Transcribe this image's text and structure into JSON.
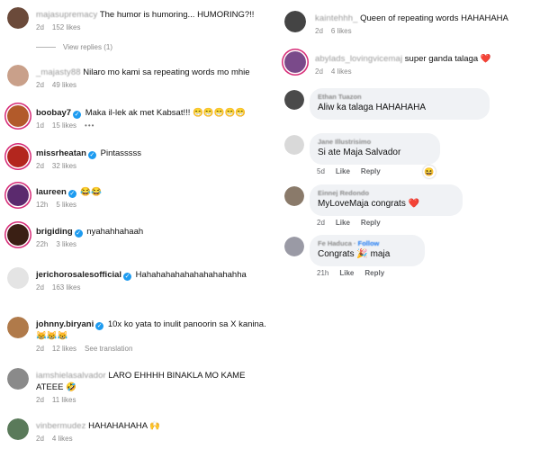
{
  "left": [
    {
      "user": "majasupremacy",
      "blurred": true,
      "verified": false,
      "text": "The humor is humoring... HUMORING?!!",
      "time": "2d",
      "likes": "152 likes",
      "avatar": "#6b4a3a",
      "story": false
    },
    {
      "user": "_majasty88",
      "blurred": true,
      "verified": false,
      "text": "Nilaro mo kami sa repeating words mo mhie",
      "time": "2d",
      "likes": "49 likes",
      "avatar": "#c9a08a",
      "story": false
    },
    {
      "user": "boobay7",
      "blurred": false,
      "verified": true,
      "text": "Maka il-lek ak met Kabsat!!! 😁😁😁😁😁",
      "time": "1d",
      "likes": "15 likes",
      "avatar": "#b25a2a",
      "story": true,
      "dots": "•••"
    },
    {
      "user": "missrheatan",
      "blurred": false,
      "verified": true,
      "text": "Pintasssss",
      "time": "2d",
      "likes": "32 likes",
      "avatar": "#b3261e",
      "story": true
    },
    {
      "user": "laureen",
      "blurred": false,
      "verified": true,
      "text": "😂😂",
      "time": "12h",
      "likes": "5 likes",
      "avatar": "#5b2a6e",
      "story": true
    },
    {
      "user": "brigiding",
      "blurred": false,
      "verified": true,
      "text": "nyahahhahaah",
      "time": "22h",
      "likes": "3 likes",
      "avatar": "#3a1f14",
      "story": true
    },
    {
      "user": "jerichorosalesofficial",
      "blurred": false,
      "verified": true,
      "text": "Hahahahahahahahahahahha",
      "time": "2d",
      "likes": "163 likes",
      "avatar": "#e4e4e4",
      "story": false
    },
    {
      "user": "johnny.biryani",
      "blurred": false,
      "verified": true,
      "text": "10x ko yata to inulit panoorin sa X kanina.",
      "text2": "😹😹😹",
      "time": "2d",
      "likes": "12 likes",
      "extra": "See translation",
      "avatar": "#b07a4a",
      "story": false
    },
    {
      "user": "iamshielasalvador",
      "blurred": true,
      "verified": false,
      "text": "LARO EHHHH BINAKLA MO KAME",
      "text2": "ATEEE 🤣",
      "time": "2d",
      "likes": "11 likes",
      "avatar": "#8a8a8a",
      "story": false
    },
    {
      "user": "vinbermudez",
      "blurred": true,
      "verified": false,
      "text": "HAHAHAHAHA 🙌",
      "time": "2d",
      "likes": "4 likes",
      "avatar": "#5a7a5a",
      "story": false
    }
  ],
  "view_replies": "View replies (1)",
  "right_ig": [
    {
      "user": "kaintehhh_",
      "text": "Queen of repeating words HAHAHAHA",
      "time": "2d",
      "likes": "6 likes",
      "avatar": "#444444"
    },
    {
      "user": "abylads_lovingvicemaj",
      "text": "super ganda talaga ❤️",
      "time": "2d",
      "likes": "4 likes",
      "avatar": "#7a4a8a",
      "story": true
    }
  ],
  "right_fb": [
    {
      "name": "Ethan Tuazon",
      "text": "Aliw ka talaga HAHAHAHA",
      "avatar": "#4a4a4a",
      "meta": []
    },
    {
      "name": "Jane Illustrisimo",
      "text": "Si ate Maja Salvador",
      "avatar": "#d9d9d9",
      "meta": [
        "5d",
        "Like",
        "Reply"
      ],
      "react": "😆"
    },
    {
      "name": "Einnej Redondo",
      "text": "MyLoveMaja congrats ❤️",
      "avatar": "#8a7a6a",
      "meta": [
        "2d",
        "Like",
        "Reply"
      ]
    },
    {
      "name": "Fe Haduca",
      "follow": "Follow",
      "text": "Congrats 🎉 maja",
      "avatar": "#9a9aa5",
      "meta": [
        "21h",
        "Like",
        "Reply"
      ]
    }
  ]
}
